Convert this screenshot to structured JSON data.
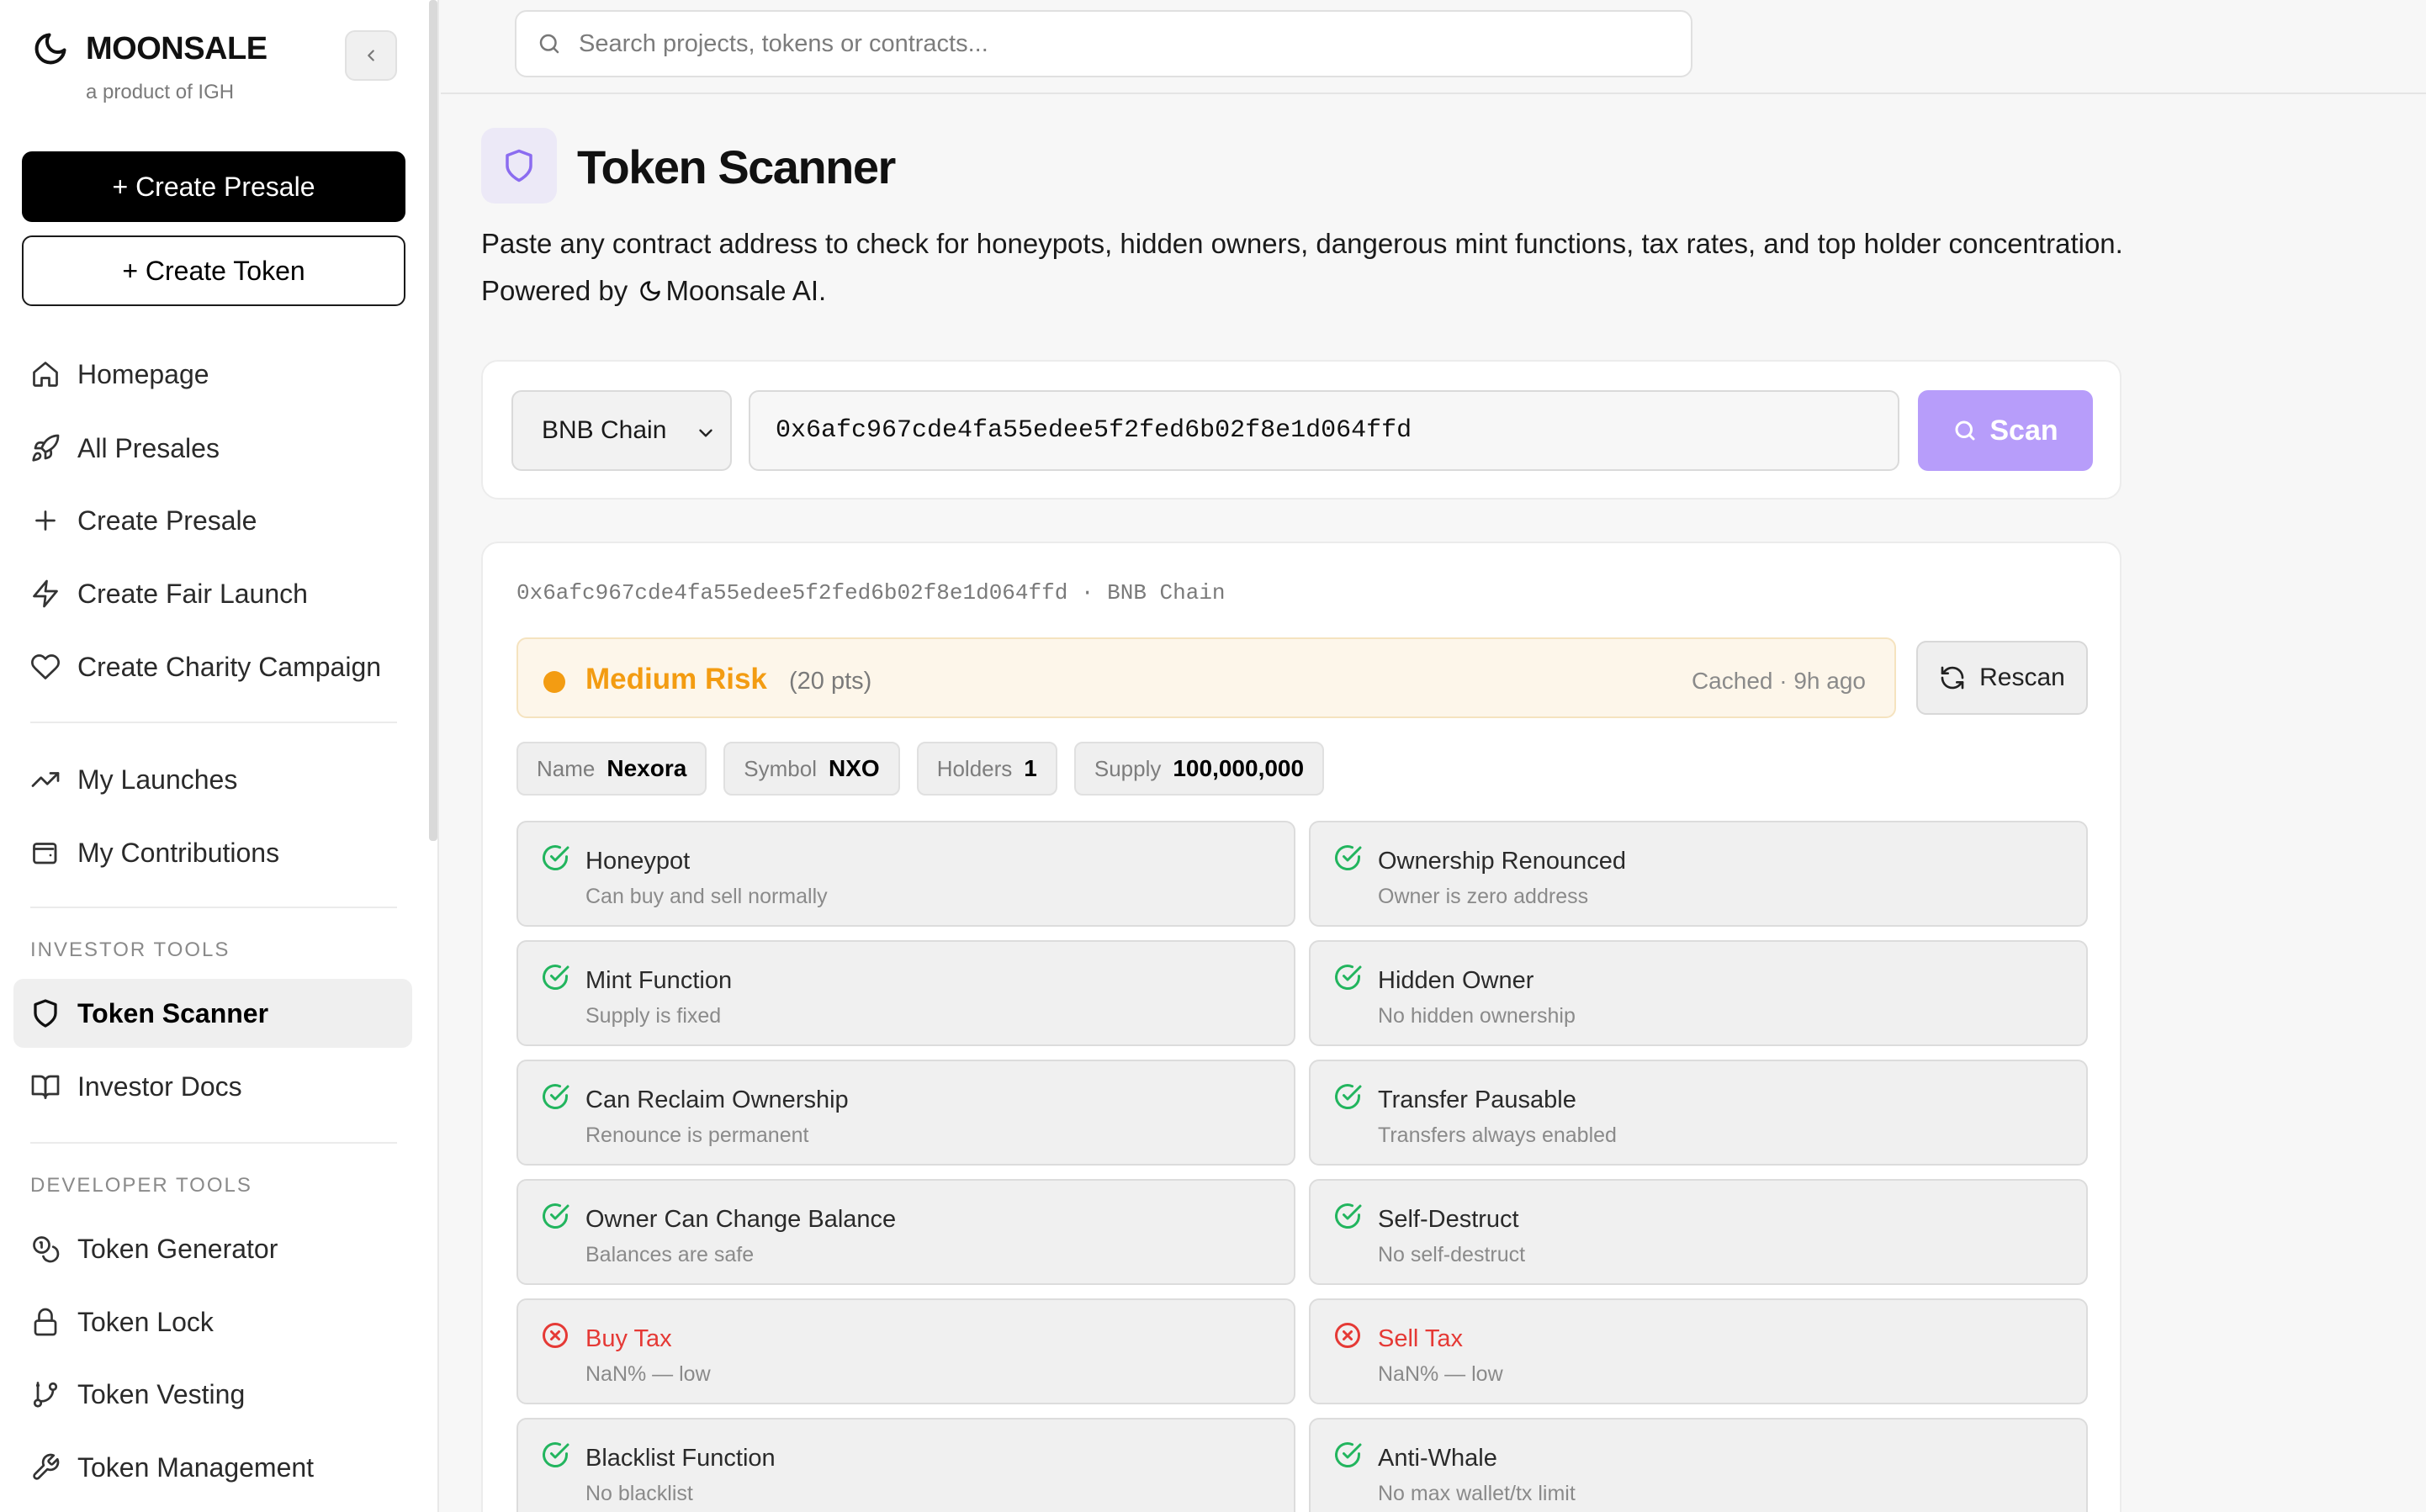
{
  "brand": {
    "name": "MOONSALE",
    "tagline": "a product of IGH"
  },
  "sidebar": {
    "create_presale_label": "+ Create Presale",
    "create_token_label": "+ Create Token",
    "nav": [
      {
        "label": "Homepage",
        "icon": "home-icon"
      },
      {
        "label": "All Presales",
        "icon": "rocket-icon"
      },
      {
        "label": "Create Presale",
        "icon": "plus-icon"
      },
      {
        "label": "Create Fair Launch",
        "icon": "lightning-icon"
      },
      {
        "label": "Create Charity Campaign",
        "icon": "heart-icon"
      },
      {
        "label": "My Launches",
        "icon": "trending-up-icon"
      },
      {
        "label": "My Contributions",
        "icon": "wallet-icon"
      }
    ],
    "investor_section": "INVESTOR TOOLS",
    "investor_items": [
      {
        "label": "Token Scanner",
        "icon": "shield-icon",
        "active": true
      },
      {
        "label": "Investor Docs",
        "icon": "book-icon"
      }
    ],
    "developer_section": "DEVELOPER TOOLS",
    "developer_items": [
      {
        "label": "Token Generator",
        "icon": "coins-icon"
      },
      {
        "label": "Token Lock",
        "icon": "lock-icon"
      },
      {
        "label": "Token Vesting",
        "icon": "git-branch-icon"
      },
      {
        "label": "Token Management",
        "icon": "wrench-icon"
      }
    ]
  },
  "search": {
    "placeholder": "Search projects, tokens or contracts..."
  },
  "page": {
    "title": "Token Scanner",
    "description": "Paste any contract address to check for honeypots, hidden owners, dangerous mint functions, tax rates, and top holder concentration.",
    "powered_prefix": "Powered by",
    "powered_name": "Moonsale AI."
  },
  "scan_form": {
    "chain": "BNB Chain",
    "address": "0x6afc967cde4fa55edee5f2fed6b02f8e1d064ffd",
    "scan_label": "Scan",
    "accent_color": "#b79dfa"
  },
  "result": {
    "meta": "0x6afc967cde4fa55edee5f2fed6b02f8e1d064ffd · BNB Chain",
    "risk_level": "Medium Risk",
    "risk_points": "(20 pts)",
    "risk_color": "#f39c12",
    "cached": "Cached · 9h ago",
    "rescan_label": "Rescan",
    "chips": [
      {
        "key": "Name",
        "value": "Nexora"
      },
      {
        "key": "Symbol",
        "value": "NXO"
      },
      {
        "key": "Holders",
        "value": "1"
      },
      {
        "key": "Supply",
        "value": "100,000,000"
      }
    ],
    "checks": [
      {
        "title": "Honeypot",
        "detail": "Can buy and sell normally",
        "status": "pass"
      },
      {
        "title": "Ownership Renounced",
        "detail": "Owner is zero address",
        "status": "pass"
      },
      {
        "title": "Mint Function",
        "detail": "Supply is fixed",
        "status": "pass"
      },
      {
        "title": "Hidden Owner",
        "detail": "No hidden ownership",
        "status": "pass"
      },
      {
        "title": "Can Reclaim Ownership",
        "detail": "Renounce is permanent",
        "status": "pass"
      },
      {
        "title": "Transfer Pausable",
        "detail": "Transfers always enabled",
        "status": "pass"
      },
      {
        "title": "Owner Can Change Balance",
        "detail": "Balances are safe",
        "status": "pass"
      },
      {
        "title": "Self-Destruct",
        "detail": "No self-destruct",
        "status": "pass"
      },
      {
        "title": "Buy Tax",
        "detail": "NaN% — low",
        "status": "fail"
      },
      {
        "title": "Sell Tax",
        "detail": "NaN% — low",
        "status": "fail"
      },
      {
        "title": "Blacklist Function",
        "detail": "No blacklist",
        "status": "pass"
      },
      {
        "title": "Anti-Whale",
        "detail": "No max wallet/tx limit",
        "status": "pass"
      }
    ],
    "pass_color": "#22b55e",
    "fail_color": "#e53935"
  }
}
